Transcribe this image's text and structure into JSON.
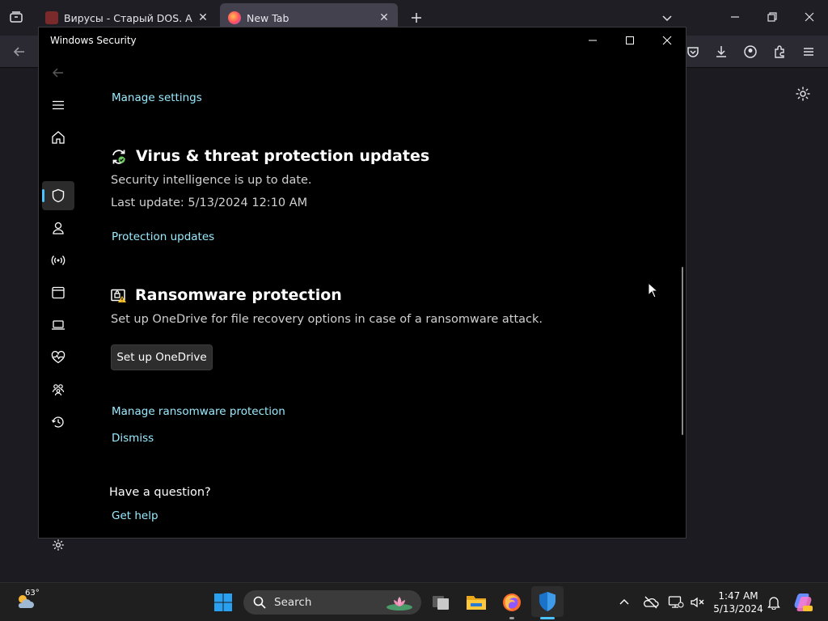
{
  "firefox": {
    "tabs": [
      {
        "label": "Вирусы - Старый DOS. Abandonware",
        "active": false
      },
      {
        "label": "New Tab",
        "active": true
      }
    ]
  },
  "window": {
    "title": "Windows Security"
  },
  "sidebar": {
    "items": [
      {
        "name": "back-icon"
      },
      {
        "name": "menu-icon"
      },
      {
        "name": "home-icon"
      },
      {
        "name": "shield-icon"
      },
      {
        "name": "account-icon"
      },
      {
        "name": "network-icon"
      },
      {
        "name": "app-browser-icon"
      },
      {
        "name": "device-security-icon"
      },
      {
        "name": "health-icon"
      },
      {
        "name": "family-icon"
      },
      {
        "name": "history-icon"
      },
      {
        "name": "settings-icon"
      }
    ],
    "active": 3
  },
  "content": {
    "manage_settings": "Manage settings",
    "updates": {
      "title": "Virus & threat protection updates",
      "status": "Security intelligence is up to date.",
      "last_update": "Last update: 5/13/2024 12:10 AM",
      "link": "Protection updates"
    },
    "ransomware": {
      "title": "Ransomware protection",
      "description": "Set up OneDrive for file recovery options in case of a ransomware attack.",
      "button": "Set up OneDrive",
      "manage_link": "Manage ransomware protection",
      "dismiss_link": "Dismiss"
    },
    "question": {
      "title": "Have a question?",
      "link": "Get help"
    }
  },
  "taskbar": {
    "weather_temp": "63°",
    "search_label": "Search",
    "time": "1:47 AM",
    "date": "5/13/2024",
    "apps": [
      {
        "name": "start-button",
        "active": false
      },
      {
        "name": "task-view",
        "active": false
      },
      {
        "name": "file-explorer",
        "active": false
      },
      {
        "name": "firefox",
        "active": true
      },
      {
        "name": "windows-security",
        "active": true
      }
    ]
  },
  "colors": {
    "link": "#99ebff",
    "accent": "#4cc2ff",
    "window_bg": "#000000",
    "taskbar_bg": "#1f1f1f"
  }
}
